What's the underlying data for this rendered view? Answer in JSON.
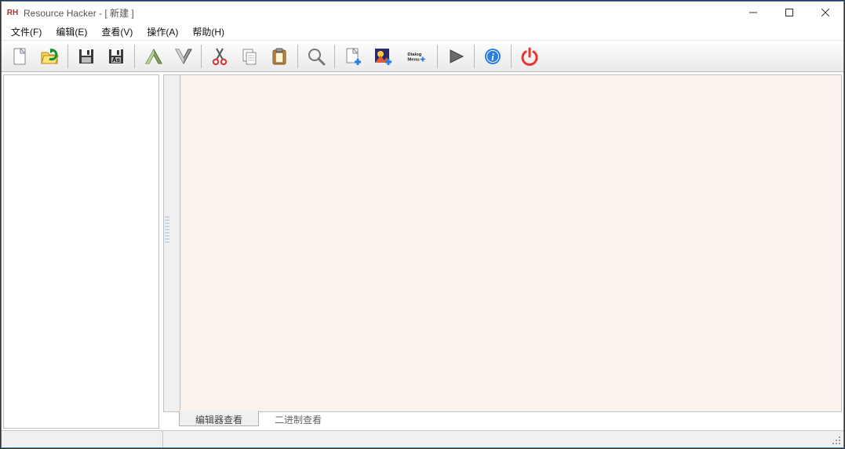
{
  "app": {
    "icon_text": "RH",
    "title": "Resource Hacker - [ 新建 ]"
  },
  "menu": {
    "file": "文件(F)",
    "edit": "编辑(E)",
    "view": "查看(V)",
    "action": "操作(A)",
    "help": "帮助(H)"
  },
  "toolbar": {
    "new": "new-file",
    "open": "open-file",
    "save": "save",
    "saveas": "save-as",
    "importres": "import-res",
    "exportres": "export-res",
    "cut": "cut",
    "copy": "copy",
    "paste": "paste",
    "find": "find",
    "addblank": "add-blank",
    "addimage": "add-image",
    "adddialog_text_top": "Dialog",
    "adddialog_text_bot": "Menu",
    "compile": "compile",
    "about": "about",
    "exit": "exit"
  },
  "tabs": {
    "editor": "编辑器查看",
    "binary": "二进制查看"
  }
}
